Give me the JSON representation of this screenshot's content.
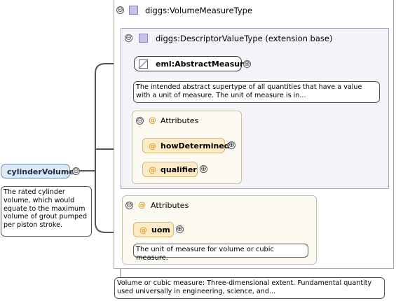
{
  "root": {
    "name": "cylinderVolume",
    "doc": "The rated cylinder volume, which would equate to the maximum volume of grout pumped per piston stroke."
  },
  "type": {
    "name": "diggs:VolumeMeasureType",
    "doc": "Volume or cubic measure: Three-dimensional extent. Fundamental quantity used universally in engineering, science, and..."
  },
  "base": {
    "name": "diggs:DescriptorValueType (extension base)",
    "abstract": {
      "name": "eml:AbstractMeasure",
      "doc": "The intended abstract supertype of all quantities that have a value with a unit of measure. The unit of measure is in..."
    },
    "attributes": {
      "title": "Attributes",
      "items": [
        {
          "name": "howDetermined"
        },
        {
          "name": "qualifier"
        }
      ]
    }
  },
  "attributes": {
    "title": "Attributes",
    "uom": {
      "name": "uom",
      "doc": "The unit of measure for volume or cubic measure."
    }
  },
  "icons": {
    "collapse": "⊖",
    "expand": "⊕",
    "at": "@"
  },
  "colors": {
    "type_icon": "#c8c2e6",
    "attribute_bg": "#fdebc6",
    "root_bg": "#dde8f5"
  }
}
